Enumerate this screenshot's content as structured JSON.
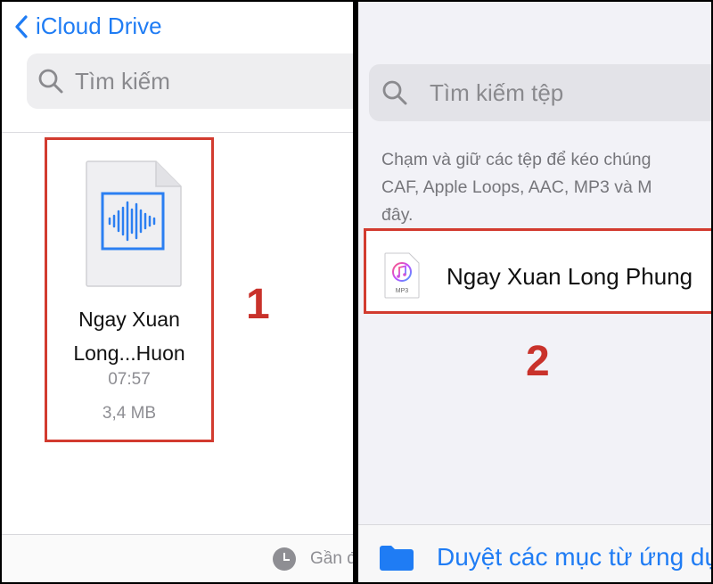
{
  "left": {
    "back_label": "iCloud Drive",
    "search_placeholder": "Tìm kiếm",
    "file": {
      "name_line1": "Ngay Xuan",
      "name_line2": "Long...Huon",
      "time": "07:57",
      "size": "3,4 MB"
    },
    "marker": "1",
    "recent_label": "Gần đây"
  },
  "right": {
    "search_placeholder": "Tìm kiếm tệp",
    "hint_lines": [
      "Chạm và giữ các tệp để kéo chúng",
      "CAF, Apple Loops, AAC, MP3 và M",
      "đây."
    ],
    "row_name": "Ngay Xuan Long Phung",
    "mp3_badge": "MP3",
    "marker": "2",
    "browse_label": "Duyệt các mục từ ứng dụng"
  },
  "colors": {
    "accent": "#1f7cf4",
    "highlight": "#d23b2f",
    "marker": "#c9322b",
    "secondary_text": "#8e8e93"
  },
  "icons": [
    "chevron-left-icon",
    "search-icon",
    "audio-file-icon",
    "mp3-music-icon",
    "clock-icon",
    "folder-icon"
  ]
}
